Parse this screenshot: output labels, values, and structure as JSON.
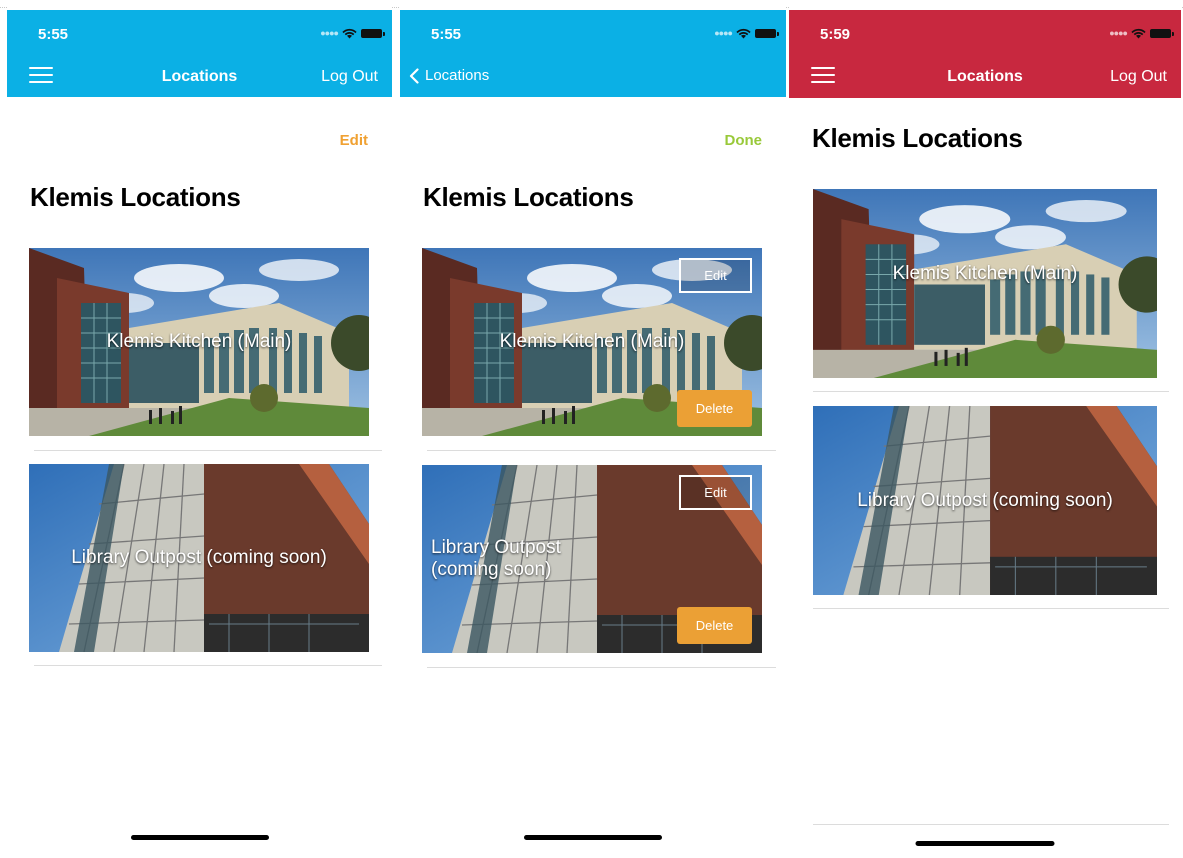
{
  "colors": {
    "blue_bar": "#0bb0e5",
    "red_bar": "#c8283f",
    "edit_orange": "#f0a132",
    "done_green": "#99c93a",
    "delete_orange": "#eba035"
  },
  "screen1": {
    "status": {
      "time": "5:55"
    },
    "nav": {
      "title": "Locations",
      "right_label": "Log Out"
    },
    "edit_label": "Edit",
    "heading": "Klemis Locations",
    "cards": [
      {
        "label": "Klemis Kitchen (Main)"
      },
      {
        "label": "Library Outpost (coming soon)"
      }
    ]
  },
  "screen2": {
    "status": {
      "time": "5:55"
    },
    "nav": {
      "back_label": "Locations"
    },
    "done_label": "Done",
    "heading": "Klemis Locations",
    "cards": [
      {
        "label": "Klemis Kitchen (Main)",
        "edit_label": "Edit",
        "delete_label": "Delete"
      },
      {
        "label": "Library Outpost (coming soon)",
        "edit_label": "Edit",
        "delete_label": "Delete"
      }
    ]
  },
  "screen3": {
    "status": {
      "time": "5:59"
    },
    "nav": {
      "title": "Locations",
      "right_label": "Log Out"
    },
    "heading": "Klemis Locations",
    "cards": [
      {
        "label": "Klemis Kitchen (Main)"
      },
      {
        "label": "Library Outpost (coming soon)"
      }
    ]
  }
}
